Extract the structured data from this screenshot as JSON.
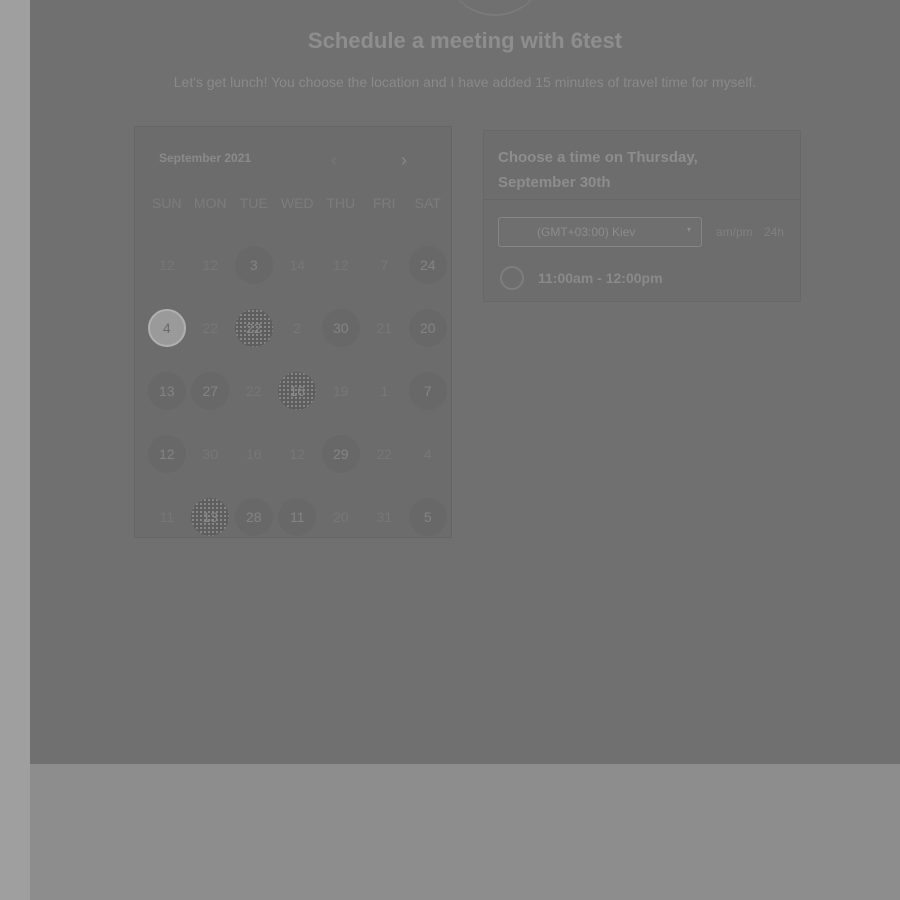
{
  "page": {
    "title": "Schedule a meeting with 6test",
    "description": "Let's get lunch! You choose the location and I have added 15 minutes of travel time for myself."
  },
  "calendar": {
    "month_label": "September 2021",
    "prev_icon": "‹",
    "next_icon": "›",
    "weekdays": [
      "SUN",
      "MON",
      "TUE",
      "WED",
      "THU",
      "FRI",
      "SAT"
    ],
    "days": [
      {
        "label": "12",
        "state": "plain"
      },
      {
        "label": "12",
        "state": "plain"
      },
      {
        "label": "3",
        "state": "available"
      },
      {
        "label": "14",
        "state": "plain"
      },
      {
        "label": "12",
        "state": "plain"
      },
      {
        "label": "7",
        "state": "plain"
      },
      {
        "label": "24",
        "state": "available"
      },
      {
        "label": "4",
        "state": "selected"
      },
      {
        "label": "22",
        "state": "plain"
      },
      {
        "label": "22",
        "state": "dotted"
      },
      {
        "label": "2",
        "state": "plain"
      },
      {
        "label": "30",
        "state": "available"
      },
      {
        "label": "21",
        "state": "plain"
      },
      {
        "label": "20",
        "state": "available"
      },
      {
        "label": "13",
        "state": "available"
      },
      {
        "label": "27",
        "state": "available"
      },
      {
        "label": "22",
        "state": "plain"
      },
      {
        "label": "16",
        "state": "dotted"
      },
      {
        "label": "19",
        "state": "plain"
      },
      {
        "label": "1",
        "state": "plain"
      },
      {
        "label": "7",
        "state": "available"
      },
      {
        "label": "12",
        "state": "available"
      },
      {
        "label": "30",
        "state": "plain"
      },
      {
        "label": "16",
        "state": "plain"
      },
      {
        "label": "12",
        "state": "plain"
      },
      {
        "label": "29",
        "state": "available"
      },
      {
        "label": "22",
        "state": "plain"
      },
      {
        "label": "4",
        "state": "plain"
      },
      {
        "label": "11",
        "state": "plain"
      },
      {
        "label": "13",
        "state": "dotted"
      },
      {
        "label": "28",
        "state": "available"
      },
      {
        "label": "11",
        "state": "available"
      },
      {
        "label": "20",
        "state": "plain"
      },
      {
        "label": "31",
        "state": "plain"
      },
      {
        "label": "5",
        "state": "available"
      }
    ]
  },
  "time_panel": {
    "heading": "Choose a time on Thursday, September 30th",
    "timezone": "(GMT+03:00) Kiev",
    "timezone_caret": "▾",
    "format_ampm": "am/pm",
    "format_24h": "24h",
    "slots": [
      "11:00am - 12:00pm"
    ]
  }
}
